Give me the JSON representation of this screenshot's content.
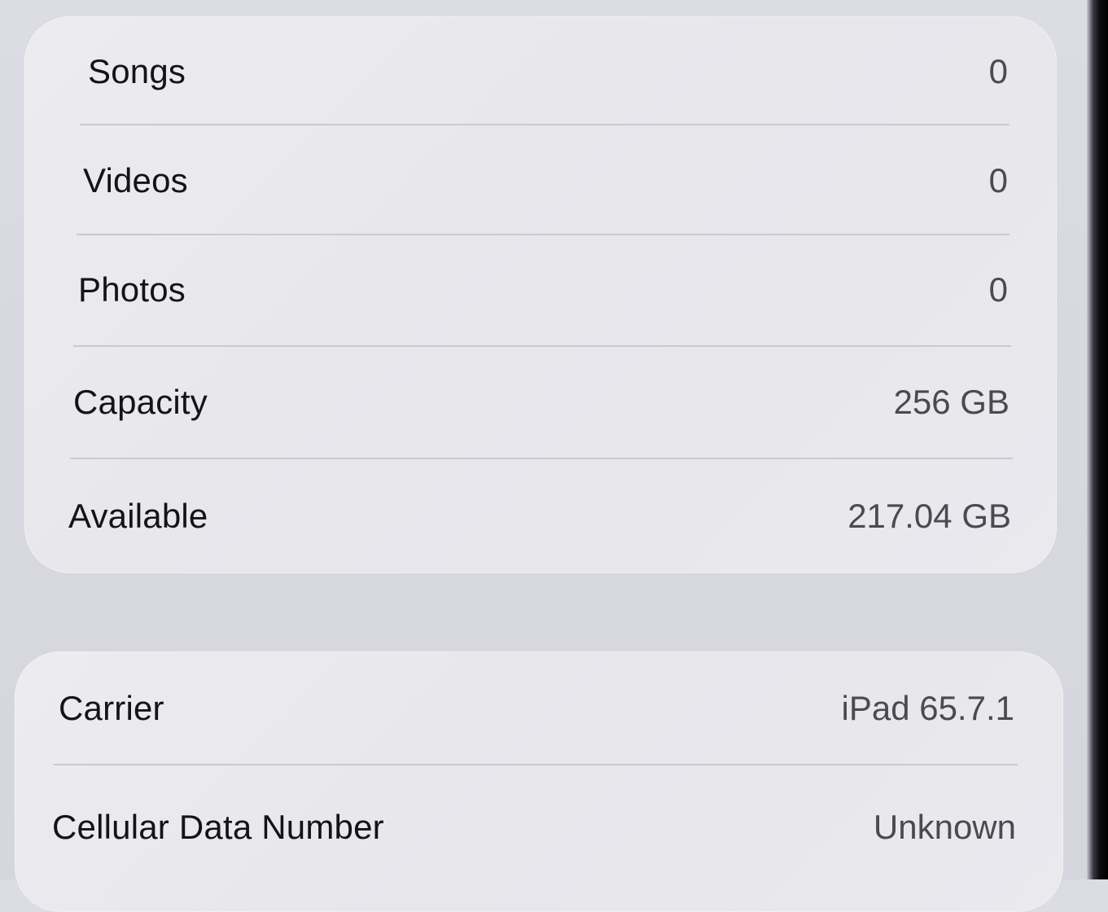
{
  "storage": {
    "rows": [
      {
        "label": "Songs",
        "value": "0"
      },
      {
        "label": "Videos",
        "value": "0"
      },
      {
        "label": "Photos",
        "value": "0"
      },
      {
        "label": "Capacity",
        "value": "256 GB"
      },
      {
        "label": "Available",
        "value": "217.04 GB"
      }
    ]
  },
  "network": {
    "rows": [
      {
        "label": "Carrier",
        "value": "iPad 65.7.1"
      },
      {
        "label": "Cellular Data Number",
        "value": "Unknown"
      }
    ]
  }
}
